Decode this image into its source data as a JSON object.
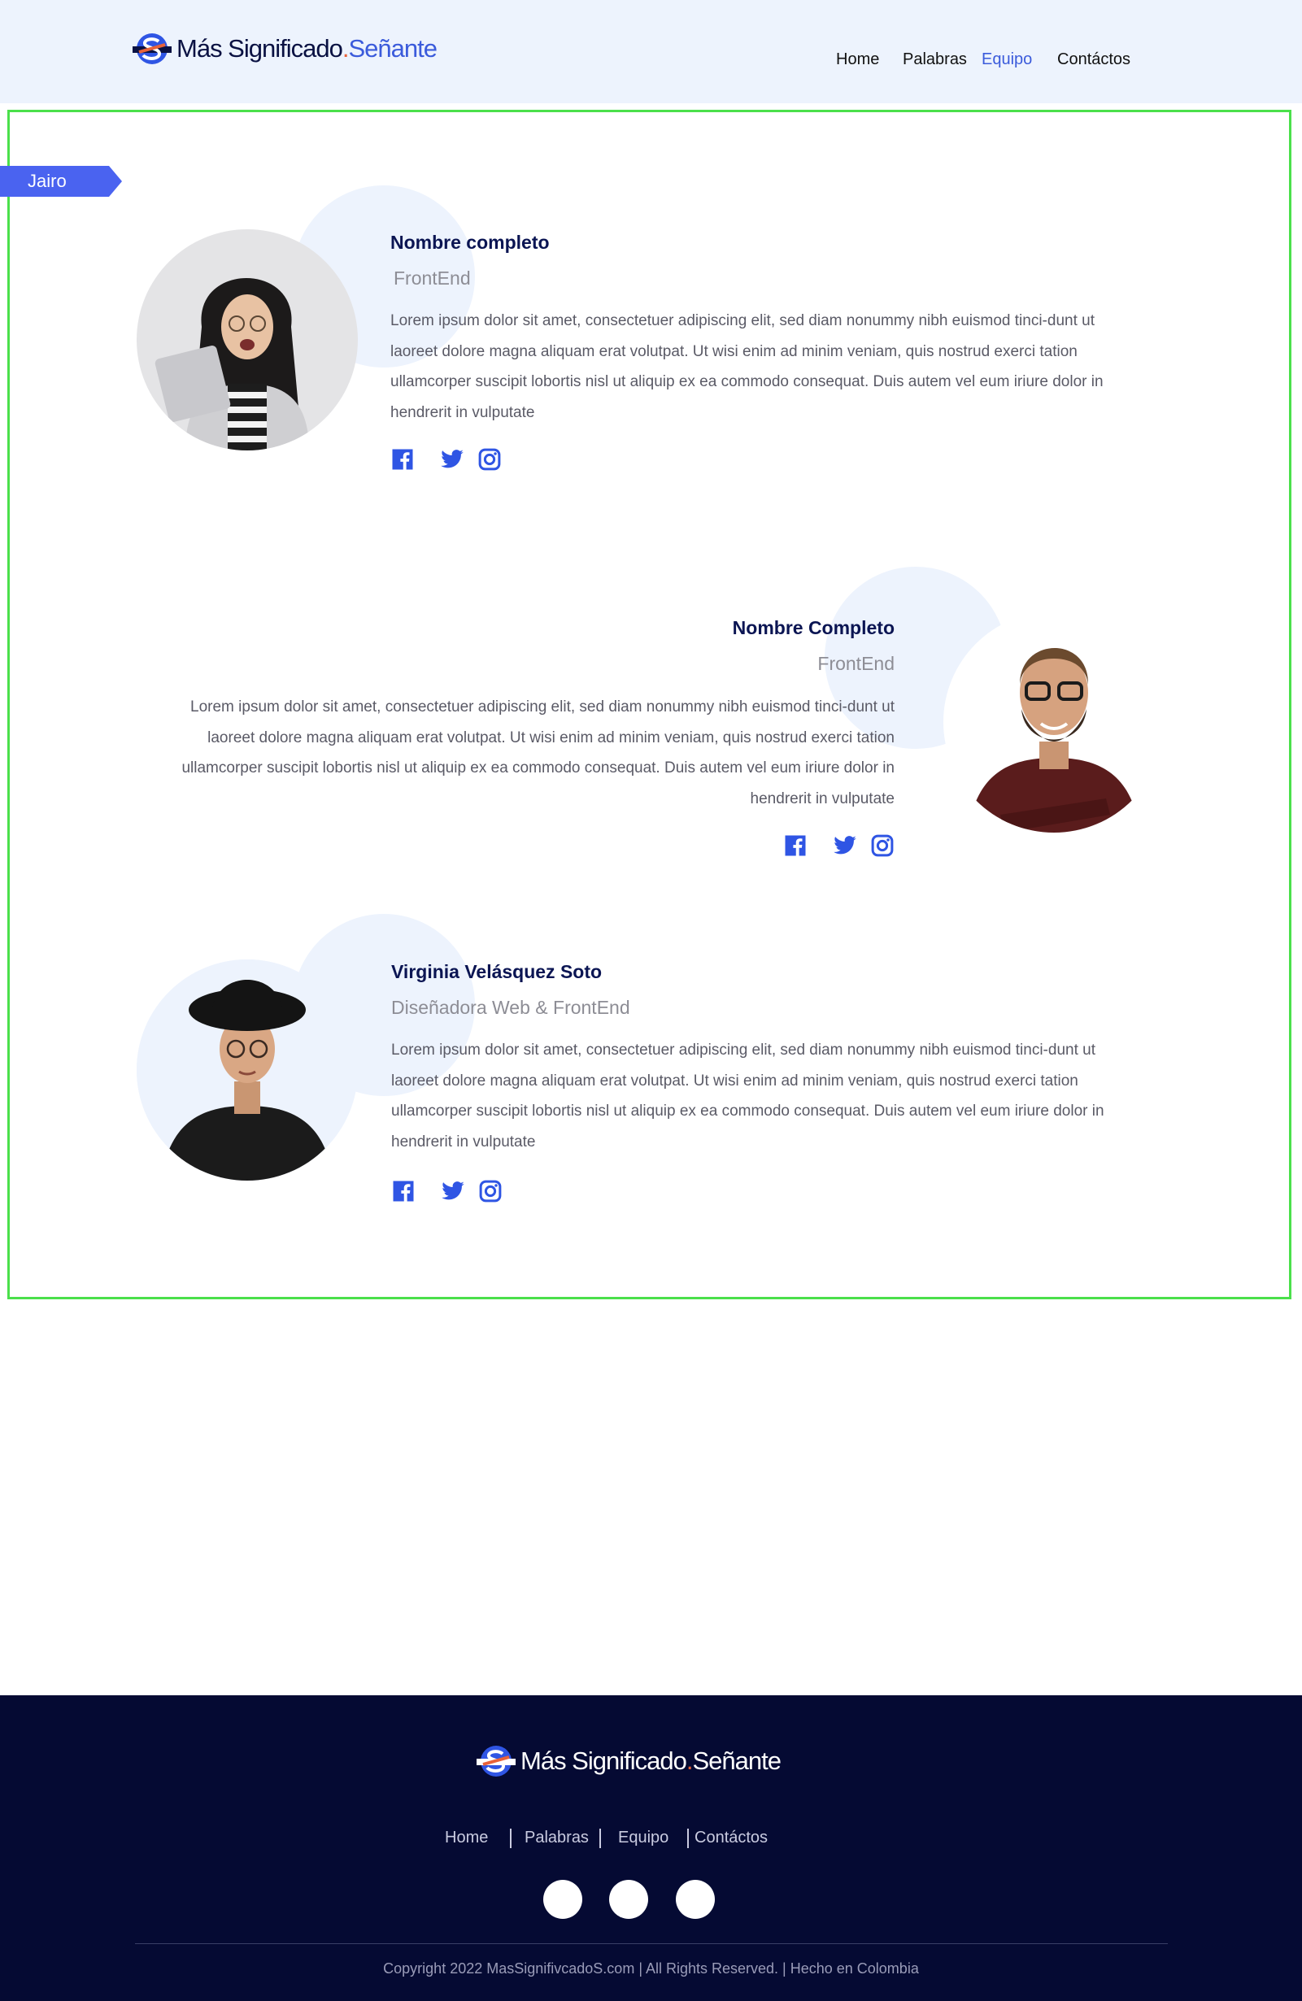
{
  "header": {
    "logo": {
      "part1": "Más Significado",
      "dot": ".",
      "part2": "Señante"
    },
    "nav": [
      {
        "label": "Home"
      },
      {
        "label": "Palabras"
      },
      {
        "label": "Equipo"
      },
      {
        "label": "Contáctos"
      }
    ],
    "active_nav": "Equipo",
    "colors": {
      "background": "#edf3fd",
      "accent": "#3b5bdb",
      "logo_dark": "#0a1142"
    }
  },
  "team": {
    "tag_label": "Jairo",
    "members": [
      {
        "name": "Nombre completo",
        "role": "FrontEnd",
        "bio": "Lorem ipsum dolor sit amet, consectetuer adipiscing elit, sed diam nonummy nibh euismod tinci-dunt ut laoreet dolore magna aliquam erat volutpat. Ut wisi enim ad minim veniam, quis nostrud exerci tation ullamcorper suscipit lobortis nisl ut aliquip ex ea commodo consequat. Duis autem vel eum iriure dolor in hendrerit in vulputate",
        "socials": [
          "facebook-icon",
          "twitter-icon",
          "instagram-icon"
        ]
      },
      {
        "name": "Nombre Completo",
        "role": "FrontEnd",
        "bio": "Lorem ipsum dolor sit amet, consectetuer adipiscing elit, sed diam nonummy nibh euismod tinci-dunt ut laoreet dolore magna aliquam erat volutpat. Ut wisi enim ad minim veniam, quis nostrud exerci tation ullamcorper suscipit lobortis nisl ut aliquip ex ea commodo consequat. Duis autem vel eum iriure dolor in hendrerit in vulputate",
        "socials": [
          "facebook-icon",
          "twitter-icon",
          "instagram-icon"
        ]
      },
      {
        "name": "Virginia Velásquez Soto",
        "role": "Diseñadora Web & FrontEnd",
        "bio": "Lorem ipsum dolor sit amet, consectetuer adipiscing elit, sed diam nonummy nibh euismod tinci-dunt ut laoreet dolore magna aliquam erat volutpat. Ut wisi enim ad minim veniam, quis nostrud exerci tation ullamcorper suscipit lobortis nisl ut aliquip ex ea commodo consequat. Duis autem vel eum iriure dolor in hendrerit in vulputate",
        "socials": [
          "facebook-icon",
          "twitter-icon",
          "instagram-icon"
        ]
      }
    ],
    "colors": {
      "social_icon": "#2f55e4",
      "name": "#0b1553",
      "role": "#8d8d95",
      "tag": "#4a63f0"
    }
  },
  "footer": {
    "logo": {
      "part1": "Más Significado",
      "dot": ".",
      "part2": "Señante"
    },
    "nav": [
      {
        "label": "Home"
      },
      {
        "label": "Palabras"
      },
      {
        "label": "Equipo"
      },
      {
        "label": "Contáctos"
      }
    ],
    "copyright": "Copyright 2022 MasSignifivcadoS.com | All Rights Reserved.  |  Hecho en Colombia",
    "colors": {
      "background": "#050a33"
    }
  }
}
